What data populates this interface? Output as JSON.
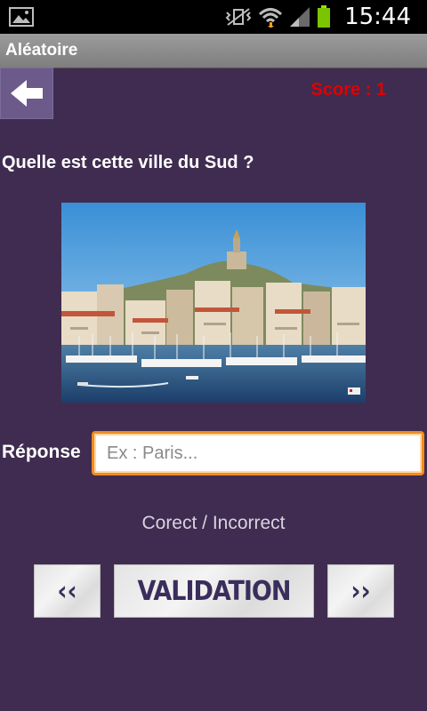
{
  "status_bar": {
    "time": "15:44"
  },
  "title_bar": {
    "title": "Aléatoire"
  },
  "game": {
    "score": "Score : 1",
    "question": "Quelle est cette ville du Sud ?",
    "answer_label": "Réponse",
    "answer_placeholder": "Ex : Paris...",
    "answer_value": "",
    "feedback": "Corect / Incorrect",
    "prev_label": "‹‹",
    "validation_label": "VALIDATION",
    "next_label": "››"
  },
  "colors": {
    "background": "#402c50",
    "score": "#e00000",
    "input_border": "#f28c1e"
  }
}
